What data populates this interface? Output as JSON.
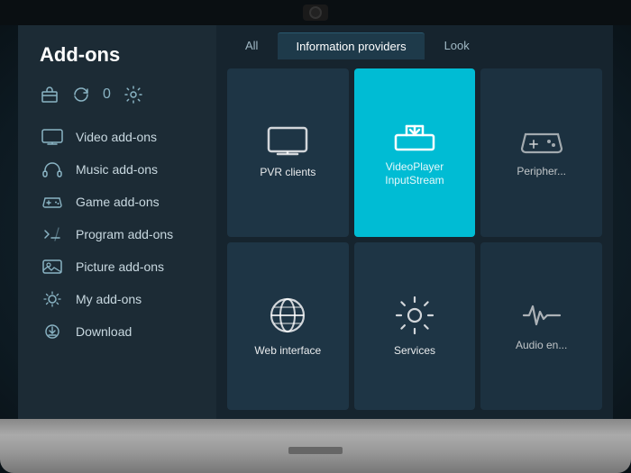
{
  "title": "Add-ons",
  "sidebar": {
    "title": "Add-ons",
    "toolbar": {
      "badge": "0"
    },
    "nav_items": [
      {
        "id": "video",
        "label": "Video add-ons",
        "icon": "tv"
      },
      {
        "id": "music",
        "label": "Music add-ons",
        "icon": "music"
      },
      {
        "id": "game",
        "label": "Game add-ons",
        "icon": "game"
      },
      {
        "id": "program",
        "label": "Program add-ons",
        "icon": "program"
      },
      {
        "id": "picture",
        "label": "Picture add-ons",
        "icon": "picture"
      },
      {
        "id": "my",
        "label": "My add-ons",
        "icon": "star"
      },
      {
        "id": "download",
        "label": "Download",
        "icon": "download"
      }
    ]
  },
  "tabs": [
    {
      "id": "all",
      "label": "All",
      "active": false
    },
    {
      "id": "info",
      "label": "Information providers",
      "active": true
    },
    {
      "id": "look",
      "label": "Look",
      "active": false
    }
  ],
  "grid": {
    "tiles": [
      {
        "id": "pvr",
        "label": "PVR clients",
        "icon": "tv-tile",
        "active": false
      },
      {
        "id": "videoplayer",
        "label": "VideoPlayer\nInputStream",
        "icon": "download-tile",
        "active": true
      },
      {
        "id": "peripheral",
        "label": "Peripher...",
        "icon": "gamepad-tile",
        "active": false
      },
      {
        "id": "web",
        "label": "Web interface",
        "icon": "globe-tile",
        "active": false
      },
      {
        "id": "services",
        "label": "Services",
        "icon": "gear-tile",
        "active": false
      },
      {
        "id": "audio",
        "label": "Audio en...",
        "icon": "wave-tile",
        "active": false
      }
    ]
  },
  "colors": {
    "bg": "#1c2b35",
    "active_tile": "#00bcd4",
    "tile": "#1e3545",
    "text": "#c8d8e0"
  }
}
